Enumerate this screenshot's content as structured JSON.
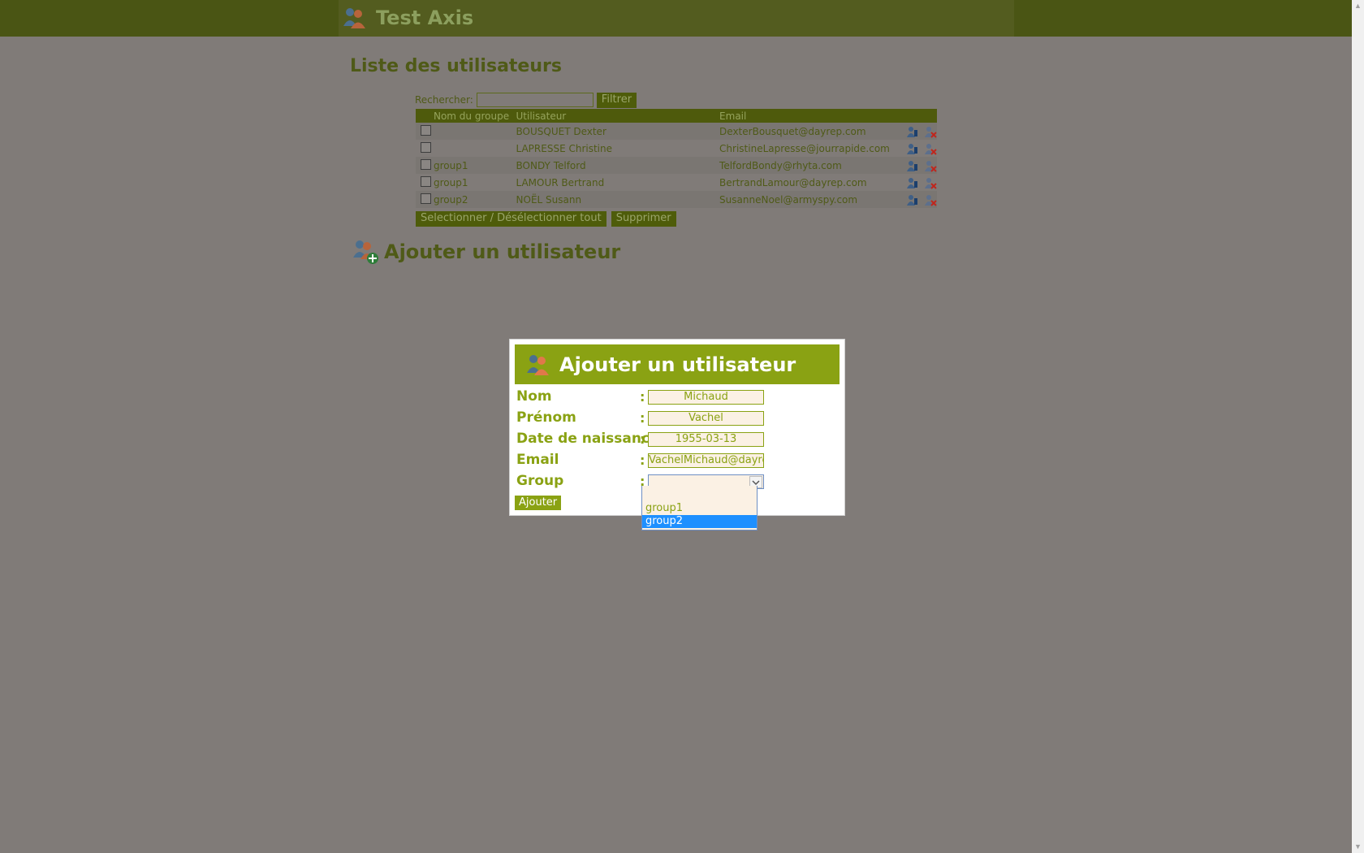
{
  "app": {
    "title": "Test Axis"
  },
  "list": {
    "title": "Liste des utilisateurs",
    "search_label": "Rechercher:",
    "search_value": "",
    "filter_button": "Filtrer",
    "columns": [
      "Nom du groupe",
      "Utilisateur",
      "Email"
    ],
    "rows": [
      {
        "group": "",
        "user": "BOUSQUET Dexter",
        "email": "DexterBousquet@dayrep.com"
      },
      {
        "group": "",
        "user": "LAPRESSE Christine",
        "email": "ChristineLapresse@jourrapide.com"
      },
      {
        "group": "group1",
        "user": "BONDY Telford",
        "email": "TelfordBondy@rhyta.com"
      },
      {
        "group": "group1",
        "user": "LAMOUR Bertrand",
        "email": "BertrandLamour@dayrep.com"
      },
      {
        "group": "group2",
        "user": "NOËL Susann",
        "email": "SusanneNoel@armyspy.com"
      }
    ],
    "select_all_button": "Selectionner / Désélectionner tout",
    "delete_button": "Supprimer"
  },
  "add_section": {
    "title": "Ajouter un utilisateur"
  },
  "modal": {
    "title": "Ajouter un utilisateur",
    "fields": {
      "nom": {
        "label": "Nom",
        "value": "Michaud"
      },
      "prenom": {
        "label": "Prénom",
        "value": "Vachel"
      },
      "date": {
        "label": "Date de naissance",
        "value": "1955-03-13"
      },
      "email": {
        "label": "Email",
        "value": "VachelMichaud@dayrep"
      },
      "group": {
        "label": "Group",
        "value": ""
      }
    },
    "colon": ":",
    "submit_button": "Ajouter",
    "group_options": [
      "",
      "group1",
      "group2"
    ],
    "highlighted_option": "group2"
  },
  "colors": {
    "header_bg": "#4a5514",
    "accent": "#8aa213",
    "overlay_bg": "#807b78",
    "highlight": "#1e90ff"
  }
}
